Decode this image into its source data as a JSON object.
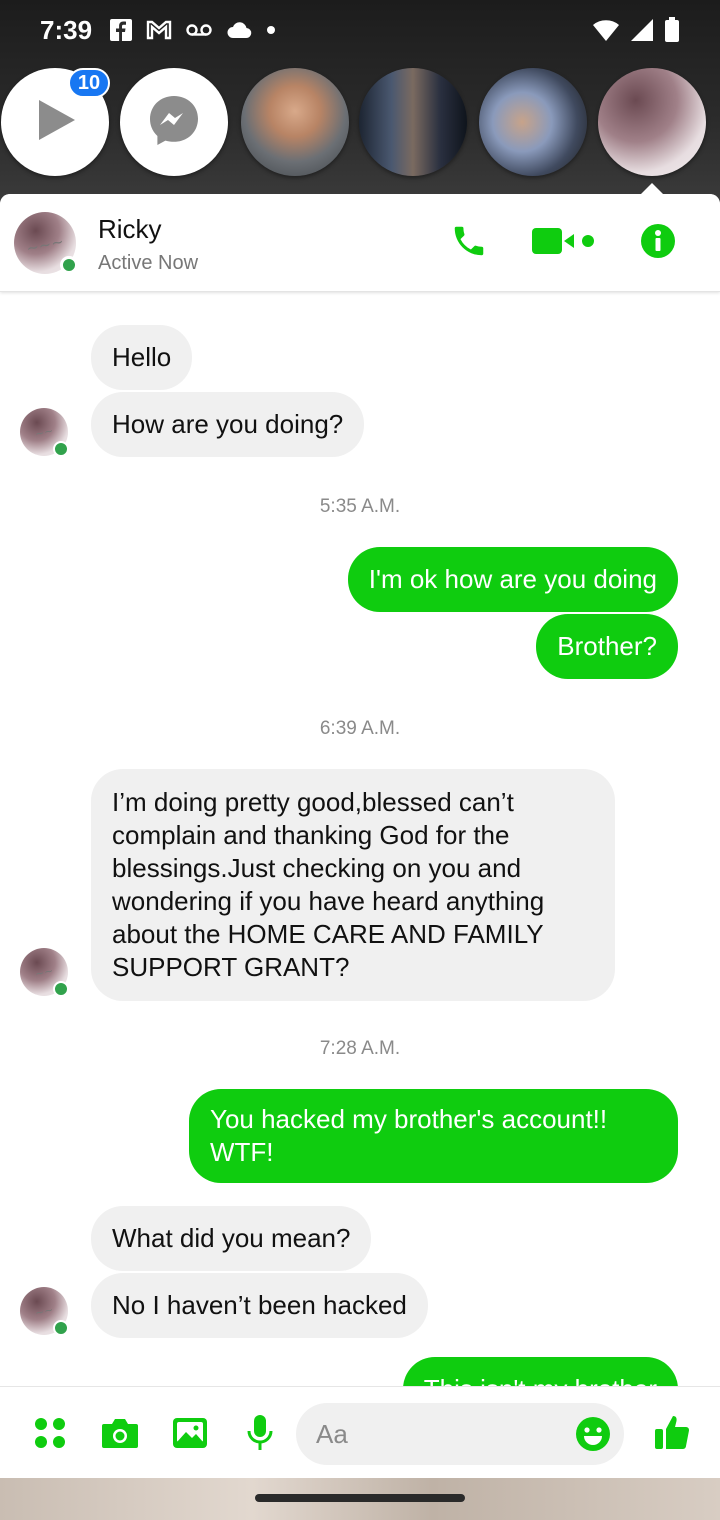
{
  "status_bar": {
    "time": "7:39"
  },
  "chat_heads": {
    "badge_count": "10"
  },
  "header": {
    "name": "Ricky",
    "status": "Active Now"
  },
  "messages": [
    {
      "type": "in",
      "text": "Hello"
    },
    {
      "type": "in",
      "text": "How are you doing?"
    },
    {
      "type": "time",
      "text": "5:35 A.M."
    },
    {
      "type": "out",
      "text": "I'm ok how are you doing"
    },
    {
      "type": "out",
      "text": "Brother?"
    },
    {
      "type": "time",
      "text": "6:39 A.M."
    },
    {
      "type": "in",
      "text": "I’m doing pretty good,blessed can’t complain and thanking God for the blessings.Just checking on you and wondering if you have heard anything about the HOME CARE AND FAMILY SUPPORT GRANT?"
    },
    {
      "type": "time",
      "text": "7:28 A.M."
    },
    {
      "type": "out",
      "text": "You hacked my brother's account!! WTF!"
    },
    {
      "type": "in",
      "text": "What did you mean?"
    },
    {
      "type": "in",
      "text": "No I haven’t been hacked"
    },
    {
      "type": "out",
      "text": "This isn't my brother"
    }
  ],
  "composer": {
    "placeholder": "Aa"
  },
  "colors": {
    "accent": "#0fcc0f",
    "badge": "#1877f2",
    "online": "#31a24c"
  }
}
